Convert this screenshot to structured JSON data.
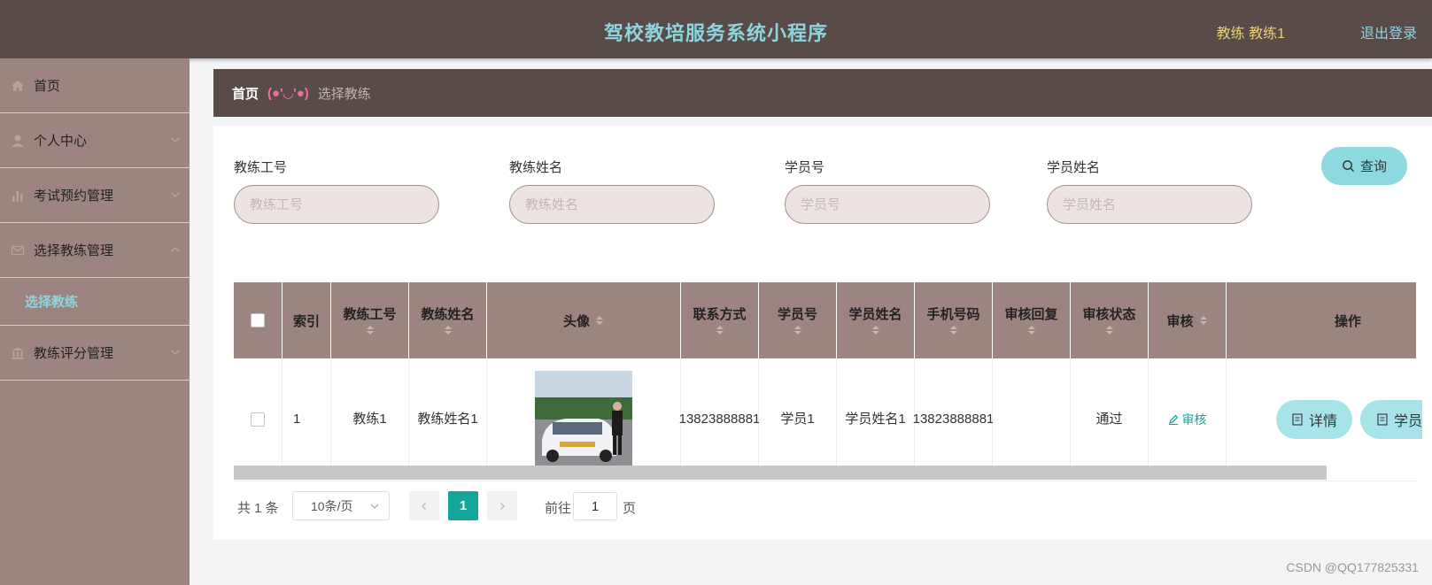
{
  "header": {
    "title": "驾校教培服务系统小程序",
    "user_label": "教练 教练1",
    "logout": "退出登录"
  },
  "sidebar": {
    "items": [
      {
        "label": "首页",
        "icon": "home-icon"
      },
      {
        "label": "个人中心",
        "icon": "user-icon"
      },
      {
        "label": "考试预约管理",
        "icon": "bar-chart-icon"
      },
      {
        "label": "选择教练管理",
        "icon": "mail-icon"
      },
      {
        "label": "教练评分管理",
        "icon": "bank-icon"
      }
    ],
    "subitem": "选择教练"
  },
  "breadcrumb": {
    "home": "首页",
    "separator": "(●'◡'●)",
    "current": "选择教练"
  },
  "filters": {
    "coach_no": {
      "label": "教练工号",
      "placeholder": "教练工号"
    },
    "coach_name": {
      "label": "教练姓名",
      "placeholder": "教练姓名"
    },
    "student_no": {
      "label": "学员号",
      "placeholder": "学员号"
    },
    "student_name": {
      "label": "学员姓名",
      "placeholder": "学员姓名"
    },
    "search_label": "查询"
  },
  "table": {
    "headers": {
      "index": "索引",
      "coach_no": "教练工号",
      "coach_name": "教练姓名",
      "avatar": "头像",
      "contact": "联系方式",
      "student_no": "学员号",
      "student_name": "学员姓名",
      "phone": "手机号码",
      "reply": "审核回复",
      "status": "审核状态",
      "audit": "审核",
      "action": "操作"
    },
    "rows": [
      {
        "index": "1",
        "coach_no": "教练1",
        "coach_name": "教练姓名1",
        "contact": "13823888881",
        "student_no": "学员1",
        "student_name": "学员姓名1",
        "phone": "13823888881",
        "reply": "",
        "status": "通过",
        "audit_link": "审核",
        "detail_button": "详情",
        "student_button": "学员"
      }
    ]
  },
  "pagination": {
    "total": "共 1 条",
    "page_size": "10条/页",
    "current_page": "1",
    "goto_prefix": "前往",
    "goto_value": "1",
    "goto_suffix": "页"
  },
  "colors": {
    "topbar": "#584b48",
    "sidebar": "#9c8581",
    "accent": "#8ed4dc",
    "active_page": "#15a59a"
  },
  "watermark": "CSDN @QQ177825331"
}
